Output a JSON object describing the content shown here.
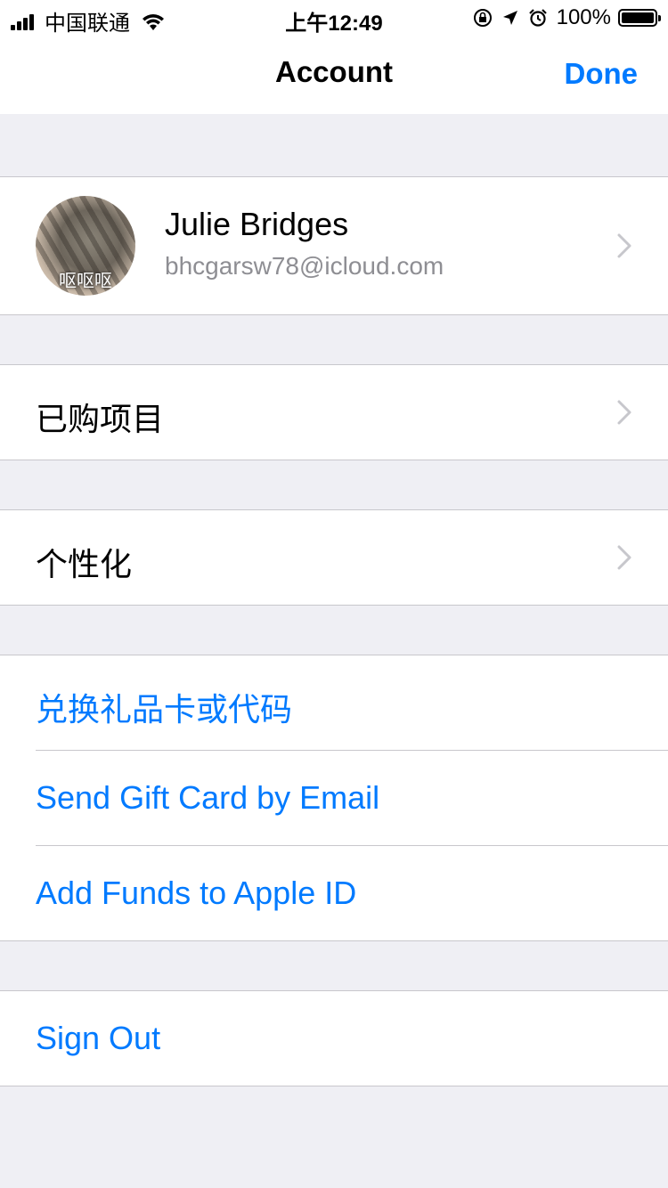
{
  "status_bar": {
    "carrier": "中国联通",
    "time": "上午12:49",
    "battery": "100%"
  },
  "nav": {
    "title": "Account",
    "done": "Done"
  },
  "profile": {
    "name": "Julie Bridges",
    "email": "bhcgarsw78@icloud.com",
    "avatar_caption": "呕呕呕"
  },
  "rows": {
    "purchased": "已购项目",
    "personalize": "个性化",
    "redeem": "兑换礼品卡或代码",
    "send_gift": "Send Gift Card by Email",
    "add_funds": "Add Funds to Apple ID",
    "sign_out": "Sign Out"
  },
  "colors": {
    "accent": "#007aff",
    "background": "#efeff4",
    "separator": "#c8c7cc",
    "secondary_text": "#8e8e93"
  }
}
